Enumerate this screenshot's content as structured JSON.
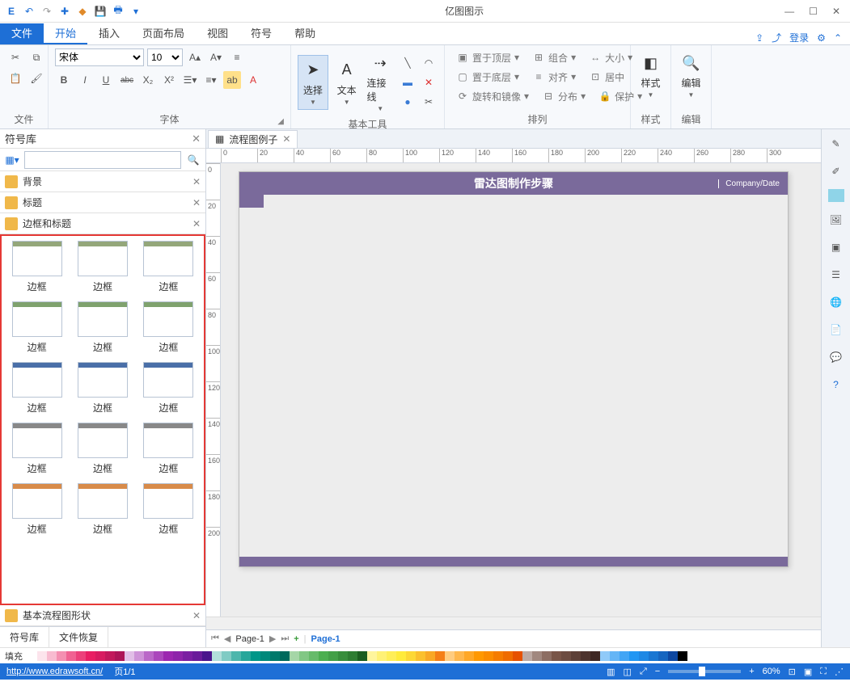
{
  "app_title": "亿图图示",
  "window": {
    "min": "—",
    "max": "☐",
    "close": "✕"
  },
  "qat": [
    "logo",
    "undo",
    "redo",
    "new",
    "open",
    "save",
    "print",
    "export"
  ],
  "menu": {
    "file": "文件",
    "items": [
      "开始",
      "插入",
      "页面布局",
      "视图",
      "符号",
      "帮助"
    ],
    "active": 0,
    "right": {
      "share": "⇪",
      "send": "⤴",
      "login": "登录",
      "gear": "⚙",
      "chev": "⌃"
    }
  },
  "ribbon": {
    "file": {
      "name": "文件"
    },
    "font": {
      "name": "字体",
      "family": "宋体",
      "size": "10",
      "bold": "B",
      "italic": "I",
      "underline": "U",
      "strike": "abc",
      "sub": "X₂",
      "sup": "X²"
    },
    "tools": {
      "name": "基本工具",
      "select": "选择",
      "text": "文本",
      "connector": "连接线"
    },
    "arrange": {
      "name": "排列",
      "front": "置于顶层",
      "back": "置于底层",
      "rotate": "旋转和镜像",
      "group": "组合",
      "align": "对齐",
      "distribute": "分布",
      "size": "大小",
      "center": "居中",
      "protect": "保护"
    },
    "style": {
      "name": "样式",
      "label": "样式"
    },
    "edit": {
      "name": "编辑",
      "label": "编辑"
    }
  },
  "sidebar": {
    "title": "符号库",
    "search_ph": "",
    "cats": [
      "背景",
      "标题",
      "边框和标题",
      "基本流程图形状"
    ],
    "shape_label": "边框",
    "tabs": [
      "符号库",
      "文件恢复"
    ]
  },
  "doc": {
    "tab": "流程图例子",
    "page_title": "雷达图制作步骤",
    "company": "Company/Date"
  },
  "ruler_h": [
    "0",
    "20",
    "40",
    "60",
    "80",
    "100",
    "120",
    "140",
    "160",
    "180",
    "200",
    "220",
    "240",
    "260",
    "280",
    "300"
  ],
  "ruler_v": [
    "0",
    "20",
    "40",
    "60",
    "80",
    "100",
    "120",
    "140",
    "160",
    "180",
    "200"
  ],
  "page_nav": {
    "label": "Page-1",
    "current": "Page-1"
  },
  "fill_label": "填充",
  "swatches": [
    "#ffffff",
    "#fce4ec",
    "#f8bbd0",
    "#f48fb1",
    "#f06292",
    "#ec407a",
    "#e91e63",
    "#d81b60",
    "#c2185b",
    "#ad1457",
    "#e1bee7",
    "#ce93d8",
    "#ba68c8",
    "#ab47bc",
    "#9c27b0",
    "#8e24aa",
    "#7b1fa2",
    "#6a1b9a",
    "#4a148c",
    "#b2dfdb",
    "#80cbc4",
    "#4db6ac",
    "#26a69a",
    "#009688",
    "#00897b",
    "#00796b",
    "#00695c",
    "#a5d6a7",
    "#81c784",
    "#66bb6a",
    "#4caf50",
    "#43a047",
    "#388e3c",
    "#2e7d32",
    "#1b5e20",
    "#fff59d",
    "#fff176",
    "#ffee58",
    "#ffeb3b",
    "#fdd835",
    "#fbc02d",
    "#f9a825",
    "#f57f17",
    "#ffcc80",
    "#ffb74d",
    "#ffa726",
    "#ff9800",
    "#fb8c00",
    "#f57c00",
    "#ef6c00",
    "#e65100",
    "#bcaaa4",
    "#a1887f",
    "#8d6e63",
    "#795548",
    "#6d4c41",
    "#5d4037",
    "#4e342e",
    "#3e2723",
    "#90caf9",
    "#64b5f6",
    "#42a5f5",
    "#2196f3",
    "#1e88e5",
    "#1976d2",
    "#1565c0",
    "#0d47a1",
    "#000000"
  ],
  "status": {
    "url": "http://www.edrawsoft.cn/",
    "page": "页1/1",
    "zoom": "60%"
  }
}
